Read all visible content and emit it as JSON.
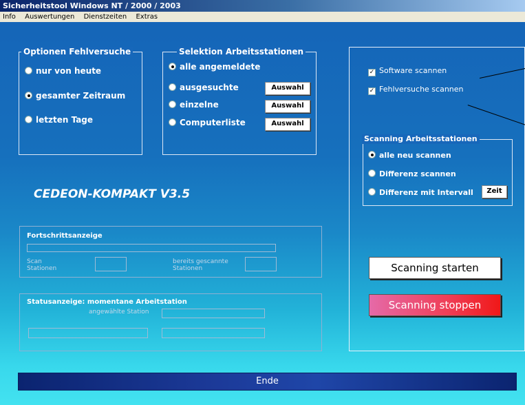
{
  "window": {
    "title": "Sicherheitstool Windows NT / 2000 / 2003"
  },
  "menu": {
    "items": [
      "Info",
      "Auswertungen",
      "Dienstzeiten",
      "Extras"
    ]
  },
  "optionen": {
    "title": "Optionen Fehlversuche",
    "options": [
      "nur von heute",
      "gesamter Zeitraum",
      "letzten Tage"
    ],
    "selected": "gesamter Zeitraum"
  },
  "selektion": {
    "title": "Selektion  Arbeitsstationen",
    "options": [
      "alle angemeldete",
      "ausgesuchte",
      "einzelne",
      "Computerliste"
    ],
    "selected": "alle angemeldete",
    "button_label": "Auswahl"
  },
  "version_label": "CEDEON-KOMPAKT    V3.5",
  "fortschritt": {
    "title": "Fortschrittsanzeige",
    "scan_label": "Scan\nStationen",
    "gescannt_label": "bereits gescannte\nStationen"
  },
  "status": {
    "title": "Statusanzeige: momentane Arbeitstation",
    "station_label": "angewählte Station"
  },
  "right_panel": {
    "software_label": "Software scannen",
    "software_checked": true,
    "fehlversuche_label": "Fehlversuche scannen",
    "fehlversuche_checked": true,
    "scanning_group": {
      "title": "Scanning Arbeitsstationen",
      "options": [
        "alle neu scannen",
        "Differenz scannen",
        "Differenz mit Intervall"
      ],
      "selected": "alle neu scannen",
      "zeit_label": "Zeit"
    },
    "start_label": "Scanning starten",
    "stop_label": "Scanning  stoppen"
  },
  "ende_label": "Ende"
}
